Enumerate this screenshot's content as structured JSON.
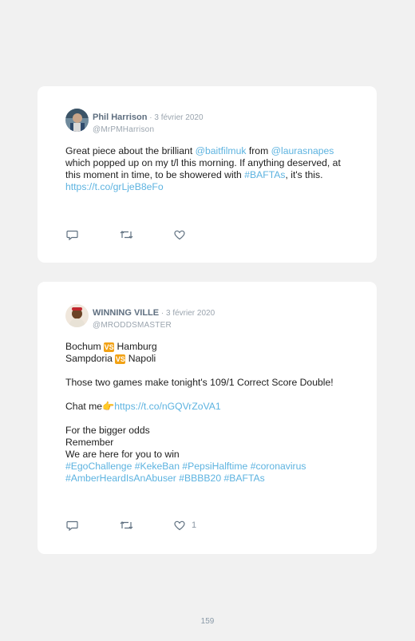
{
  "tweets": [
    {
      "author": "Phil Harrison",
      "date": " · 3 février 2020",
      "handle": "@MrPMHarrison",
      "text": {
        "p1": "Great piece about the brilliant ",
        "l1": "@baitfilmuk",
        "p2": " from ",
        "l2": "@laurasnapes",
        "p3": " which popped up on my t/l this morning. If anything deserved, at this moment in time, to be showered with ",
        "l3": "#BAFTAs",
        "p4": ", it's this.",
        "l4": "https://t.co/grLjeB8eFo"
      },
      "likes": ""
    },
    {
      "author": "WINNING VILLE",
      "date": " · 3 février 2020",
      "handle": "@MRODDSMASTER",
      "text": {
        "m1a": "Bochum ",
        "vs": "VS",
        "m1b": " Hamburg",
        "m2a": "Sampdoria ",
        "m2b": " Napoli",
        "line3": "Those two games make tonight's 109/1 Correct Score Double!",
        "chat": "Chat me",
        "emoji": "👉",
        "chat_link": "https://t.co/nGQVrZoVA1",
        "line5": "For the bigger odds",
        "line6": "Remember",
        "line7": "We are here for you to win",
        "tags1": "#EgoChallenge #KekeBan #PepsiHalftime #coronavirus",
        "tags2": "#AmberHeardIsAnAbuser #BBBB20 #BAFTAs"
      },
      "likes": "1"
    }
  ],
  "page_number": "159",
  "icons": [
    "reply-icon",
    "retweet-icon",
    "like-icon"
  ],
  "colors": {
    "link": "#5db3e0",
    "vs_badge": "#f2a215",
    "background": "#f1f1f1"
  }
}
